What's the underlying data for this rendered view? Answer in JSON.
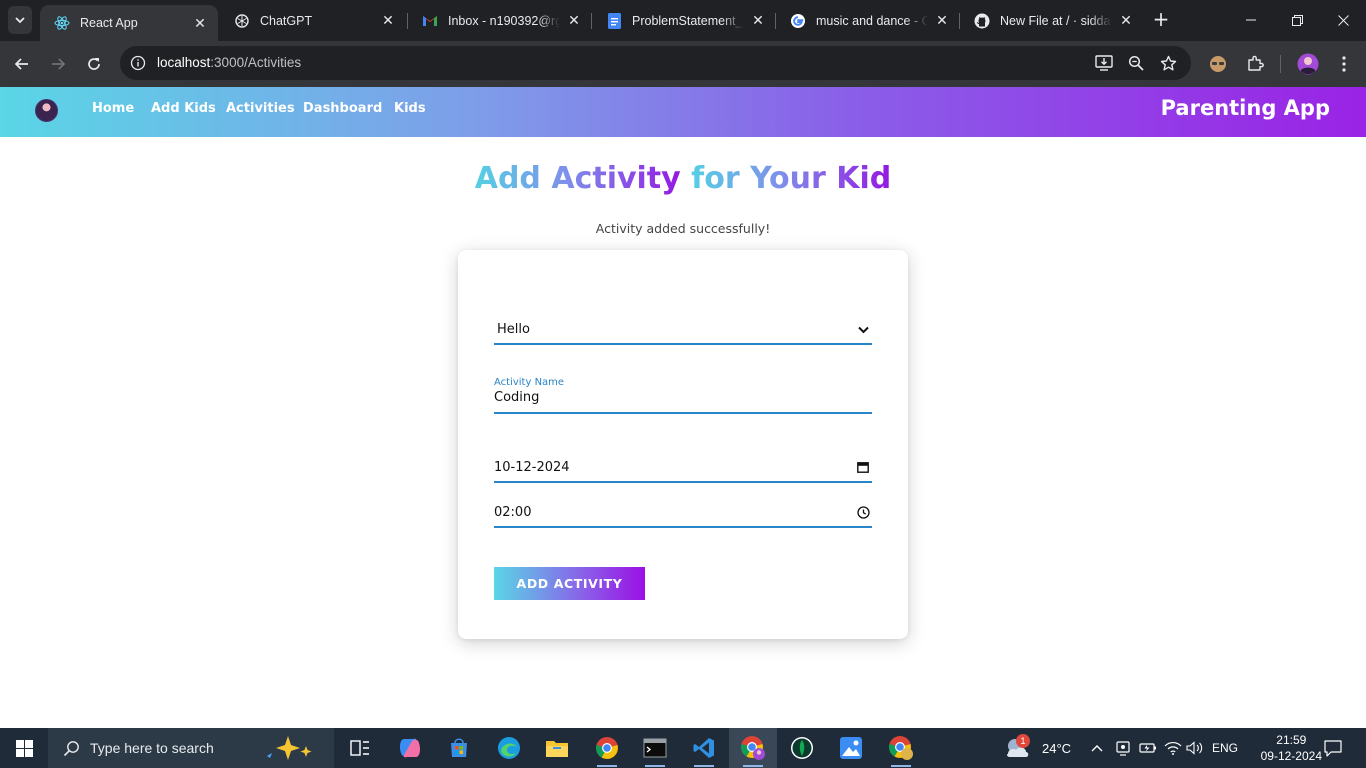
{
  "browser": {
    "tabs": [
      {
        "title": "React App",
        "icon": "react-icon",
        "active": true
      },
      {
        "title": "ChatGPT",
        "icon": "chatgpt-icon",
        "active": false
      },
      {
        "title": "Inbox - n190392@rgukt.ac.in",
        "icon": "gmail-icon",
        "active": false
      },
      {
        "title": "ProblemStatement_III",
        "icon": "google-docs-icon",
        "active": false
      },
      {
        "title": "music and dance - Google Search",
        "icon": "google-icon",
        "active": false
      },
      {
        "title": "New File at / · siddardha",
        "icon": "github-icon",
        "active": false
      }
    ],
    "url_host": "localhost",
    "url_path": ":3000/Activities"
  },
  "app": {
    "nav": {
      "links": [
        "Home",
        "Add Kids",
        "Activities",
        "Dashboard",
        "Kids"
      ],
      "brand": "Parenting App"
    },
    "page": {
      "title_part1": "Add Activity",
      "title_part2": "for Your Kid",
      "success_message": "Activity added successfully!"
    },
    "form": {
      "kid_select_value": "Hello",
      "activity_name_label": "Activity Name",
      "activity_name_value": "Coding",
      "date_value": "10-12-2024",
      "time_value": "02:00",
      "submit_label": "ADD ACTIVITY"
    }
  },
  "taskbar": {
    "search_placeholder": "Type here to search",
    "weather": "24°C",
    "language": "ENG",
    "time": "21:59",
    "date": "09-12-2024",
    "weather_badge": "1"
  },
  "colors": {
    "gradient_start": "#5ad6e6",
    "gradient_end": "#9a23e6",
    "field_accent": "#2a84c8"
  }
}
